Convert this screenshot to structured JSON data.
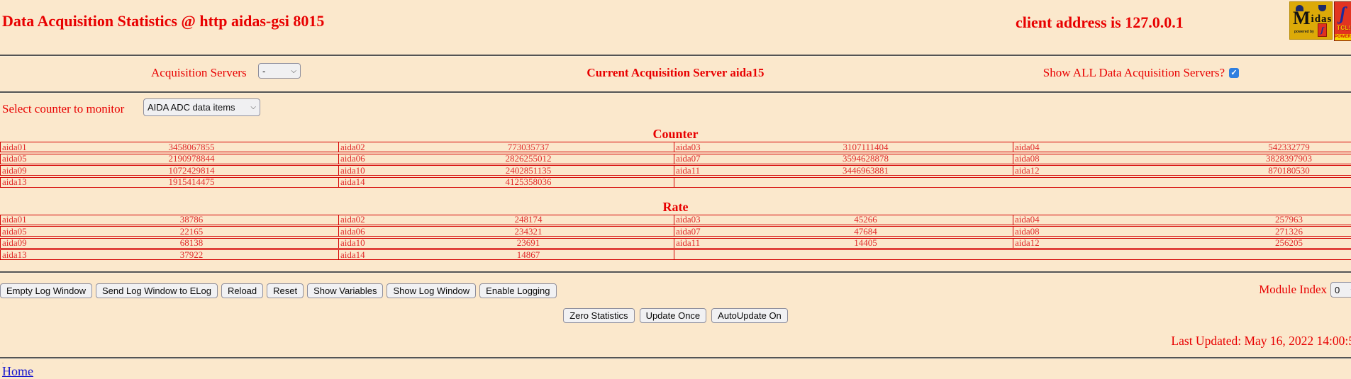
{
  "colors": {
    "background": "#fbe8cc",
    "heading_red": "#e80000",
    "table_text_red": "#e02b2b",
    "table_border_red": "#d40000",
    "checkbox_blue": "#2f7fe0",
    "link_blue": "#1515cf",
    "midas_logo_gold": "#dcaa08",
    "tcl_logo_red": "#e23420"
  },
  "header": {
    "title": "Data Acquisition Statistics @ http aidas-gsi 8015",
    "client_address": "client address is 127.0.0.1"
  },
  "logos": {
    "midas_big_letter": "M",
    "midas_rest": "idas",
    "midas_powered": "powered by",
    "midas_mini_glyph": "ʃ",
    "tcl_feather": "ʃ",
    "tcl_word": "TCL!",
    "tcl_powered": "POWERED"
  },
  "acq_row": {
    "servers_label": "Acquisition Servers",
    "servers_value": "-",
    "current_server": "Current Acquisition Server aida15",
    "show_all_label": "Show ALL Data Acquisition Servers?",
    "show_all_checked": true,
    "checkmark": "✓"
  },
  "counter_row": {
    "label": "Select counter to monitor",
    "value": "AIDA ADC data items"
  },
  "counter_table": {
    "title": "Counter",
    "rows": [
      [
        {
          "n": "aida01",
          "v": "3458067855"
        },
        {
          "n": "aida02",
          "v": "773035737"
        },
        {
          "n": "aida03",
          "v": "3107111404"
        },
        {
          "n": "aida04",
          "v": "542332779"
        }
      ],
      [
        {
          "n": "aida05",
          "v": "2190978844"
        },
        {
          "n": "aida06",
          "v": "2826255012"
        },
        {
          "n": "aida07",
          "v": "3594628878"
        },
        {
          "n": "aida08",
          "v": "3828397903"
        }
      ],
      [
        {
          "n": "aida09",
          "v": "1072429814"
        },
        {
          "n": "aida10",
          "v": "2402851135"
        },
        {
          "n": "aida11",
          "v": "3446963881"
        },
        {
          "n": "aida12",
          "v": "870180530"
        }
      ],
      [
        {
          "n": "aida13",
          "v": "1915414475"
        },
        {
          "n": "aida14",
          "v": "4125358036"
        }
      ]
    ]
  },
  "rate_table": {
    "title": "Rate",
    "rows": [
      [
        {
          "n": "aida01",
          "v": "38786"
        },
        {
          "n": "aida02",
          "v": "248174"
        },
        {
          "n": "aida03",
          "v": "45266"
        },
        {
          "n": "aida04",
          "v": "257963"
        }
      ],
      [
        {
          "n": "aida05",
          "v": "22165"
        },
        {
          "n": "aida06",
          "v": "234321"
        },
        {
          "n": "aida07",
          "v": "47684"
        },
        {
          "n": "aida08",
          "v": "271326"
        }
      ],
      [
        {
          "n": "aida09",
          "v": "68138"
        },
        {
          "n": "aida10",
          "v": "23691"
        },
        {
          "n": "aida11",
          "v": "14405"
        },
        {
          "n": "aida12",
          "v": "256205"
        }
      ],
      [
        {
          "n": "aida13",
          "v": "37922"
        },
        {
          "n": "aida14",
          "v": "14867"
        }
      ]
    ]
  },
  "toolbar": {
    "buttons": [
      "Empty Log Window",
      "Send Log Window to ELog",
      "Reload",
      "Reset",
      "Show Variables",
      "Show Log Window",
      "Enable Logging"
    ],
    "module_index_label": "Module Index",
    "module_index_value": "0"
  },
  "actions": {
    "buttons": [
      "Zero Statistics",
      "Update Once",
      "AutoUpdate On"
    ]
  },
  "status": {
    "last_updated": "Last Updated: May 16, 2022 14:00:5"
  },
  "footer": {
    "dot": ".",
    "home": "Home"
  }
}
